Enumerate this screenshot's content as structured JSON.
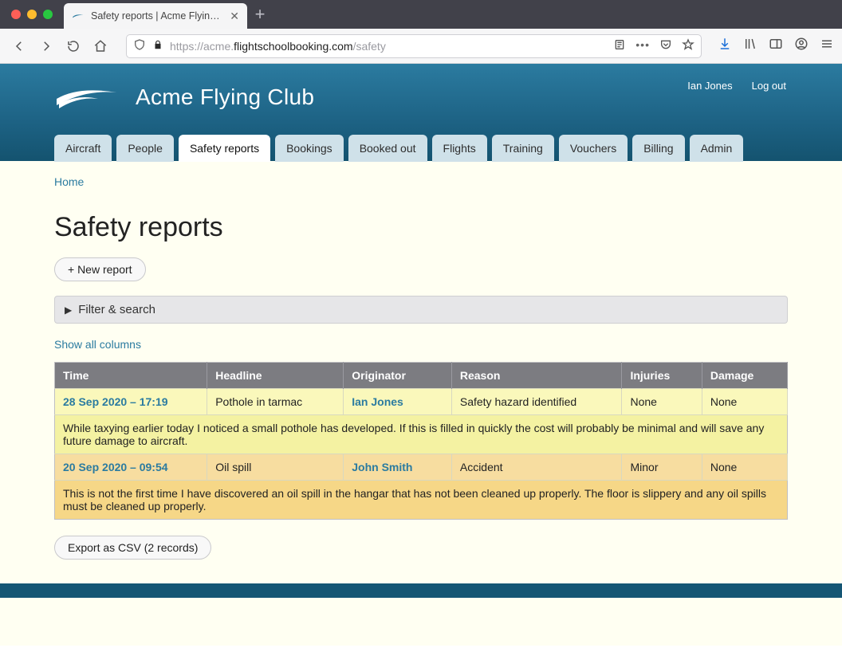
{
  "browser": {
    "tab_title": "Safety reports | Acme Flying Cl…",
    "url_prefix": "https://acme.",
    "url_domain": "flightschoolbooking.com",
    "url_path": "/safety"
  },
  "header": {
    "club_name": "Acme Flying Club",
    "user_link": "Ian Jones",
    "logout": "Log out"
  },
  "nav_tabs": [
    "Aircraft",
    "People",
    "Safety reports",
    "Bookings",
    "Booked out",
    "Flights",
    "Training",
    "Vouchers",
    "Billing",
    "Admin"
  ],
  "nav_active_index": 2,
  "breadcrumb": {
    "home": "Home"
  },
  "page": {
    "title": "Safety reports",
    "new_button": "+ New report",
    "filter_label": "Filter & search",
    "show_all": "Show all columns",
    "export_button": "Export as CSV (2 records)"
  },
  "table": {
    "columns": [
      "Time",
      "Headline",
      "Originator",
      "Reason",
      "Injuries",
      "Damage"
    ],
    "rows": [
      {
        "time": "28 Sep 2020 – 17:19",
        "headline": "Pothole in tarmac",
        "originator": "Ian Jones",
        "reason": "Safety hazard identified",
        "injuries": "None",
        "damage": "None",
        "description": "While taxying earlier today I noticed a small pothole has developed. If this is filled in quickly the cost will probably be minimal and will save any future damage to aircraft."
      },
      {
        "time": "20 Sep 2020 – 09:54",
        "headline": "Oil spill",
        "originator": "John Smith",
        "reason": "Accident",
        "injuries": "Minor",
        "damage": "None",
        "description": "This is not the first time I have discovered an oil spill in the hangar that has not been cleaned up properly. The floor is slippery and any oil spills must be cleaned up properly."
      }
    ]
  }
}
